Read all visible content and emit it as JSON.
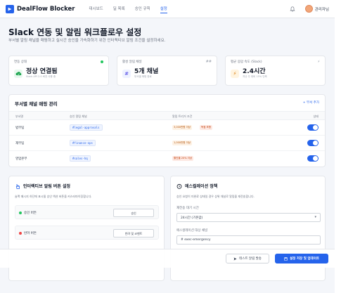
{
  "nav": {
    "brand": "DealFlow Blocker",
    "links": [
      "대시보드",
      "딜 목록",
      "승인 규칙",
      "설정"
    ],
    "active_index": 3,
    "user_name": "관리자님"
  },
  "header": {
    "title": "Slack 연동 및 알림 워크플로우 설정",
    "subtitle": "부서별 알림 채널을 매핑하고 실시간 승인을 가속화하기 위한 인터랙티브 알림 조건을 설정하세요."
  },
  "stats": [
    {
      "label": "연동 상태",
      "value": "정상 연결됨",
      "sub": "Slack API 2.0 버전 사용 중",
      "corner": ""
    },
    {
      "label": "활성 알림 채널",
      "value": "5개 채널",
      "sub": "부서별 매핑 완료",
      "corner": "##"
    },
    {
      "label": "평균 응답 속도 (Slack)",
      "value": "2.4시간",
      "sub": "지난 주 대비 15% 단축",
      "corner": "⚡"
    }
  ],
  "mapping": {
    "title": "부서별 채널 매핑 관리",
    "add_label": "+ 부서 추가",
    "columns": [
      "부서명",
      "승인 알림 채널",
      "알림 트리거 조건",
      "상태"
    ],
    "rows": [
      {
        "dept": "법무팀",
        "channel": "#legal-approvals",
        "cond1": "3,000만원 이상",
        "cond2": "독점 조항",
        "enabled": true
      },
      {
        "dept": "재무팀",
        "channel": "#finance-ops",
        "cond1": "1,000만원 이상",
        "cond2": "",
        "enabled": true
      },
      {
        "dept": "영업본부",
        "channel": "#sales-hq",
        "cond1": "",
        "cond2": "할인율 20% 이상",
        "enabled": true
      }
    ]
  },
  "interactive": {
    "title": "인터랙티브 알림 버튼 설정",
    "desc": "슬랙 메시지 하단에 표시될 승인 액션 버튼을 커스터마이징합니다.",
    "buttons": [
      {
        "label": "승인 버튼",
        "value": "승인",
        "color": "#22c55e"
      },
      {
        "label": "반려 버튼",
        "value": "반려 및 코멘트",
        "color": "#ef4444"
      }
    ]
  },
  "escalation": {
    "title": "에스컬레이션 정책",
    "desc": "승인 요청이 미완료 상태일 경우 상위 채널로 알림을 재전송합니다.",
    "wait_label": "재전송 대기 시간",
    "wait_value": "24시간 (기본값)",
    "channel_label": "에스컬레이션 대상 채널",
    "channel_value": "# exec-emergency"
  },
  "actions": {
    "test": "테스트 알림 발송",
    "save": "설정 저장 및 업데이트"
  },
  "colors": {
    "accent": "#2563eb",
    "success": "#22c55e",
    "danger": "#ef4444"
  }
}
